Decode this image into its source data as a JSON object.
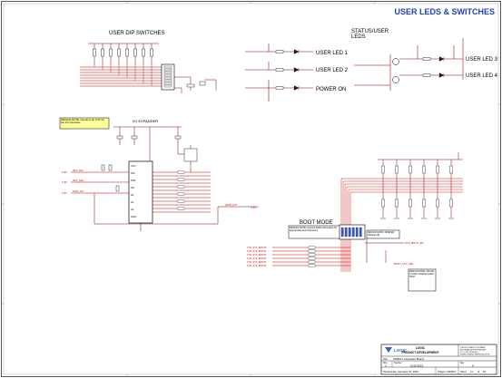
{
  "sheet": {
    "title": "USER LEDS & SWITCHES",
    "title_color": "#1f3fbf",
    "sections": {
      "dip": "USER DIP SWITCHES",
      "status_line1": "STATUS/USER",
      "status_line2": "LEDS",
      "io_expander": "I/O EXPANDER",
      "boot_mode": "BOOT MODE"
    },
    "led_labels": {
      "led1": "USER LED 1",
      "led2": "USER LED 2",
      "power": "POWER ON",
      "led3": "USER LED 3",
      "led4": "USER LED 4"
    },
    "notes": {
      "expander_note": "DESIGN NOTE: Needs to be 3.3V for the I/O expander",
      "boot_note": "DESIGN NOTE: Consult SOM schematics for appropriate boot frequency",
      "boot_default": "DESIGN NOTE: DFAB EN (Default off)",
      "boot_note3": "DESIGN NOTE: SW-ON, 1=LOW, Floating=pulled HIGH"
    },
    "colors": {
      "wire": "#8b0000",
      "bus": "#cc0000",
      "net_label": "#cc0000",
      "note_fill": "#ffff99",
      "border": "#555555"
    }
  },
  "title_block": {
    "company": "LOGIC",
    "dept": "PRODUCT DEVELOPMENT",
    "title_label": "Title",
    "title_value": "AM3517 eXpander Board",
    "size_label": "Size",
    "size_value": "C",
    "number_label": "Number",
    "number_value": "1011-0023",
    "rev_label": "Rev",
    "rev_value": "A",
    "date_value": "Wednesday, February 24, 2010",
    "project_value": "Project: AM3517",
    "sheet_label": "Sheet",
    "sheet_value": "11",
    "of_label": "of",
    "of_value": "15",
    "note_lines": [
      "THIS DOCUMENT CONTAINS",
      "INFORMATION PROPRIETARY",
      "TO LOGIC PRODUCT",
      "DEVELOPMENT, REPRODUCTION"
    ]
  }
}
